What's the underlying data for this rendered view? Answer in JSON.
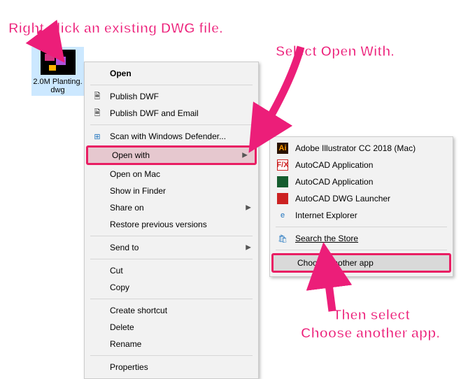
{
  "file": {
    "name": "2.0M Planting.dwg"
  },
  "menu": {
    "open": "Open",
    "publish_dwf": "Publish DWF",
    "publish_dwf_email": "Publish DWF and Email",
    "scan_defender": "Scan with Windows Defender...",
    "open_with": "Open with",
    "open_on_mac": "Open on Mac",
    "show_finder": "Show in Finder",
    "share_on": "Share on",
    "restore": "Restore previous versions",
    "send_to": "Send to",
    "cut": "Cut",
    "copy": "Copy",
    "create_shortcut": "Create shortcut",
    "delete": "Delete",
    "rename": "Rename",
    "properties": "Properties"
  },
  "submenu": {
    "illustrator": "Adobe Illustrator CC 2018 (Mac)",
    "autocad_app1": "AutoCAD Application",
    "autocad_app2": "AutoCAD Application",
    "dwg_launcher": "AutoCAD DWG Launcher",
    "ie": "Internet Explorer",
    "search_store": "Search the Store",
    "choose_another": "Choose another app"
  },
  "annot": {
    "file": "Right-click an existing DWG file.",
    "open_with": "Select Open With.",
    "choose_line1": "Then select",
    "choose_line2": "Choose another app."
  },
  "colors": {
    "accent": "#ec1e79"
  }
}
